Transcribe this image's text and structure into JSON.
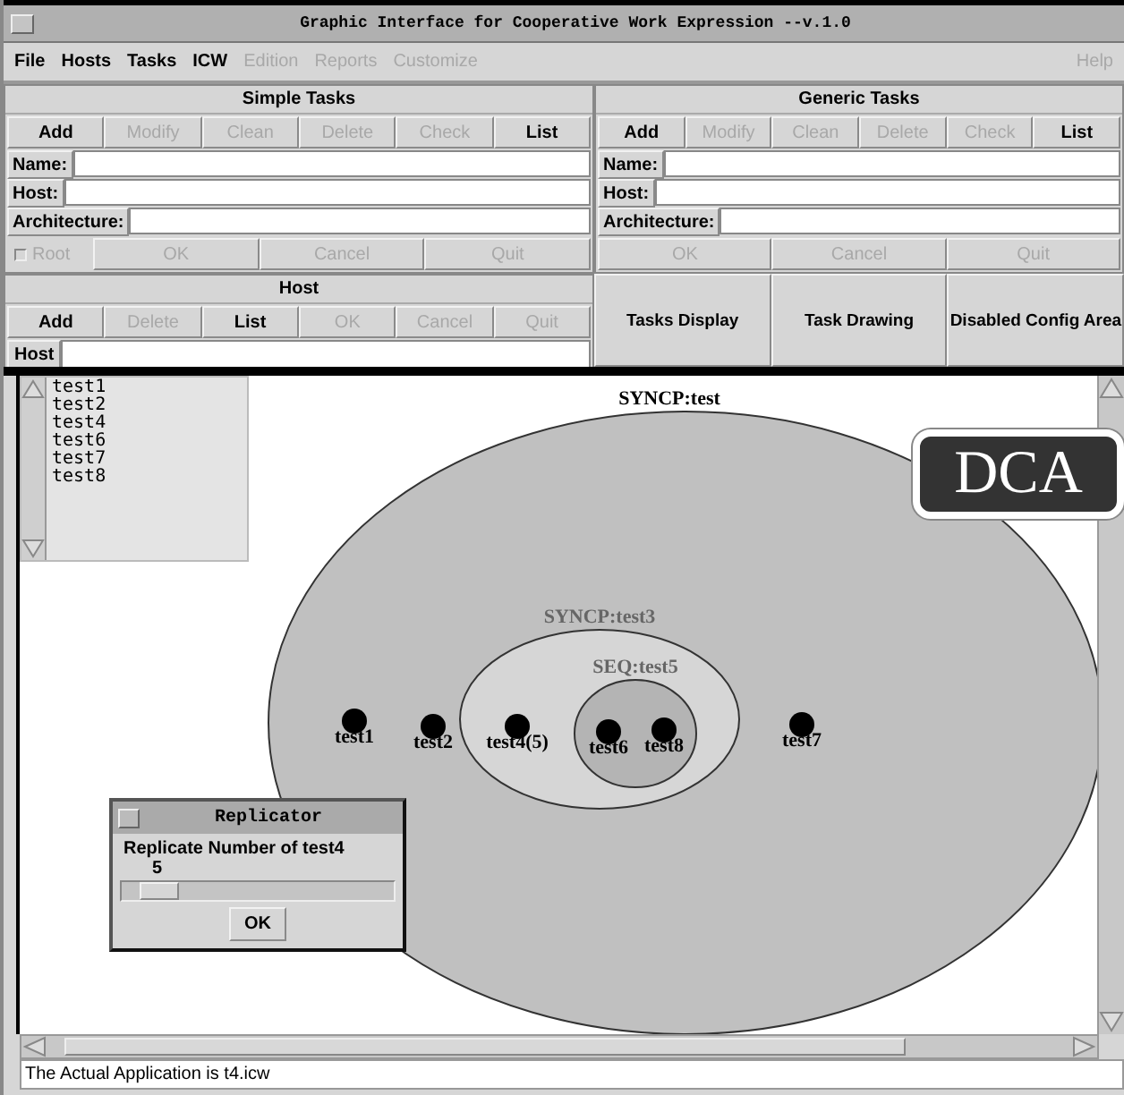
{
  "window": {
    "title": "Graphic Interface for Cooperative Work Expression --v.1.0"
  },
  "menu": [
    {
      "label": "File",
      "disabled": false
    },
    {
      "label": "Hosts",
      "disabled": false
    },
    {
      "label": "Tasks",
      "disabled": false
    },
    {
      "label": "ICW",
      "disabled": false
    },
    {
      "label": "Edition",
      "disabled": true
    },
    {
      "label": "Reports",
      "disabled": true
    },
    {
      "label": "Customize",
      "disabled": true
    }
  ],
  "help_menu": {
    "label": "Help",
    "disabled": true
  },
  "simple_tasks": {
    "title": "Simple Tasks",
    "buttons": [
      {
        "label": "Add",
        "disabled": false
      },
      {
        "label": "Modify",
        "disabled": true
      },
      {
        "label": "Clean",
        "disabled": true
      },
      {
        "label": "Delete",
        "disabled": true
      },
      {
        "label": "Check",
        "disabled": true
      },
      {
        "label": "List",
        "disabled": false
      }
    ],
    "fields": [
      {
        "label": "Name:"
      },
      {
        "label": "Host:"
      },
      {
        "label": "Architecture:"
      }
    ],
    "root": {
      "label": "Root",
      "checked": false,
      "disabled": true
    },
    "actions": [
      {
        "label": "OK",
        "disabled": true
      },
      {
        "label": "Cancel",
        "disabled": true
      },
      {
        "label": "Quit",
        "disabled": true
      }
    ]
  },
  "generic_tasks": {
    "title": "Generic Tasks",
    "buttons": [
      {
        "label": "Add",
        "disabled": false
      },
      {
        "label": "Modify",
        "disabled": true
      },
      {
        "label": "Clean",
        "disabled": true
      },
      {
        "label": "Delete",
        "disabled": true
      },
      {
        "label": "Check",
        "disabled": true
      },
      {
        "label": "List",
        "disabled": false
      }
    ],
    "fields": [
      {
        "label": "Name:"
      },
      {
        "label": "Host:"
      },
      {
        "label": "Architecture:"
      }
    ],
    "actions": [
      {
        "label": "OK",
        "disabled": true
      },
      {
        "label": "Cancel",
        "disabled": true
      },
      {
        "label": "Quit",
        "disabled": true
      }
    ]
  },
  "host": {
    "title": "Host",
    "buttons": [
      {
        "label": "Add",
        "disabled": false
      },
      {
        "label": "Delete",
        "disabled": true
      },
      {
        "label": "List",
        "disabled": false
      },
      {
        "label": "OK",
        "disabled": true
      },
      {
        "label": "Cancel",
        "disabled": true
      },
      {
        "label": "Quit",
        "disabled": true
      }
    ],
    "field_label": "Host"
  },
  "views": [
    {
      "label": "Tasks Display"
    },
    {
      "label": "Task Drawing"
    },
    {
      "label": "Disabled Config Area"
    }
  ],
  "task_list": {
    "items": [
      "test1",
      "test2",
      "test4",
      "test6",
      "test7",
      "test8"
    ]
  },
  "diagram": {
    "kind": "group",
    "label": "SYNCP:test",
    "children": [
      {
        "kind": "task",
        "label": "test1"
      },
      {
        "kind": "task",
        "label": "test2"
      },
      {
        "kind": "group",
        "label": "SYNCP:test3",
        "children": [
          {
            "kind": "task",
            "label": "test4(5)"
          },
          {
            "kind": "group",
            "label": "SEQ:test5",
            "children": [
              {
                "kind": "task",
                "label": "test6"
              },
              {
                "kind": "task",
                "label": "test8"
              }
            ]
          }
        ]
      },
      {
        "kind": "task",
        "label": "test7"
      }
    ]
  },
  "badge": {
    "label": "DCA"
  },
  "replicator": {
    "title": "Replicator",
    "prompt": "Replicate Number of test4",
    "value": "5",
    "level": 0.08,
    "button": "OK"
  },
  "status_bar": "The Actual Application is t4.icw"
}
